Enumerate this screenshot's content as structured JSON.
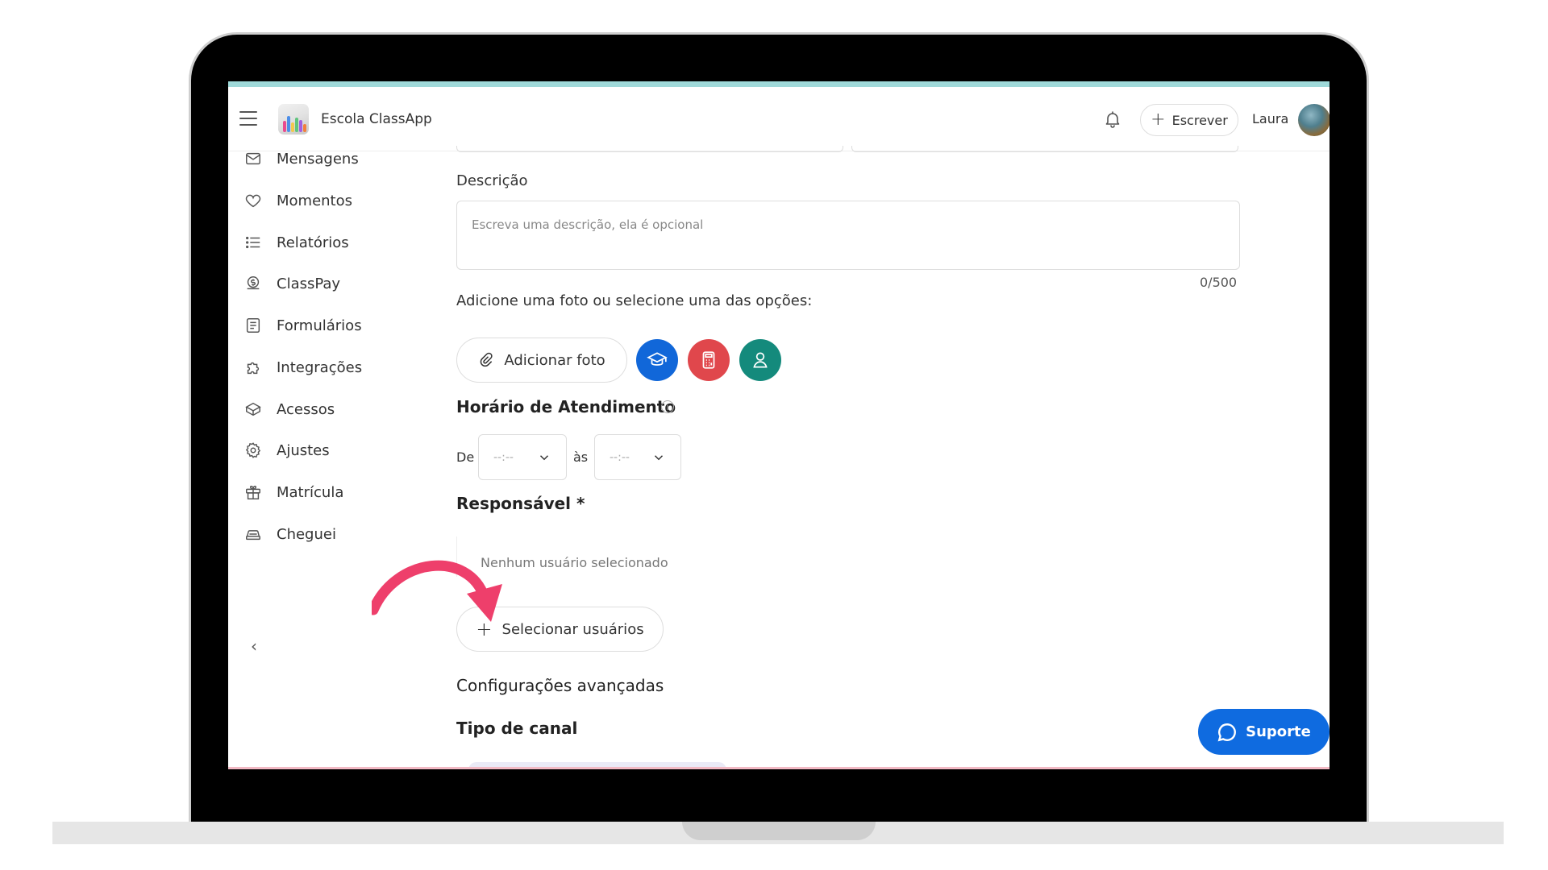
{
  "header": {
    "school_name": "Escola ClassApp",
    "write_label": "Escrever",
    "user_name": "Laura"
  },
  "sidebar": {
    "items": [
      {
        "label": "Mensagens",
        "icon": "mail-icon"
      },
      {
        "label": "Momentos",
        "icon": "heart-icon"
      },
      {
        "label": "Relatórios",
        "icon": "list-icon"
      },
      {
        "label": "ClassPay",
        "icon": "dollar-coin-icon"
      },
      {
        "label": "Formulários",
        "icon": "form-icon"
      },
      {
        "label": "Integrações",
        "icon": "puzzle-icon"
      },
      {
        "label": "Acessos",
        "icon": "cube-icon"
      },
      {
        "label": "Ajustes",
        "icon": "gear-icon"
      },
      {
        "label": "Matrícula",
        "icon": "gift-icon"
      },
      {
        "label": "Cheguei",
        "icon": "car-icon"
      }
    ],
    "collapse_glyph": "‹"
  },
  "form": {
    "description_label": "Descrição",
    "description_placeholder": "Escreva uma descrição, ela é opcional",
    "description_counter": "0/500",
    "photo_prompt": "Adicione uma foto ou selecione uma das opções:",
    "add_photo_label": "Adicionar foto",
    "hours_title": "Horário de Atendimento",
    "from_label": "De",
    "to_label": "às",
    "from_value": "--:--",
    "to_value": "--:--",
    "responsible_title": "Responsável *",
    "no_user_text": "Nenhum usuário selecionado",
    "select_users_label": "Selecionar usuários",
    "advanced_title": "Configurações avançadas",
    "channel_type_title": "Tipo de canal"
  },
  "support": {
    "label": "Suporte"
  },
  "colors": {
    "blue_option": "#1167d9",
    "red_option": "#e0474c",
    "teal_option": "#148a7c",
    "support_button": "#0f6be0",
    "arrow": "#ee3f6b"
  }
}
